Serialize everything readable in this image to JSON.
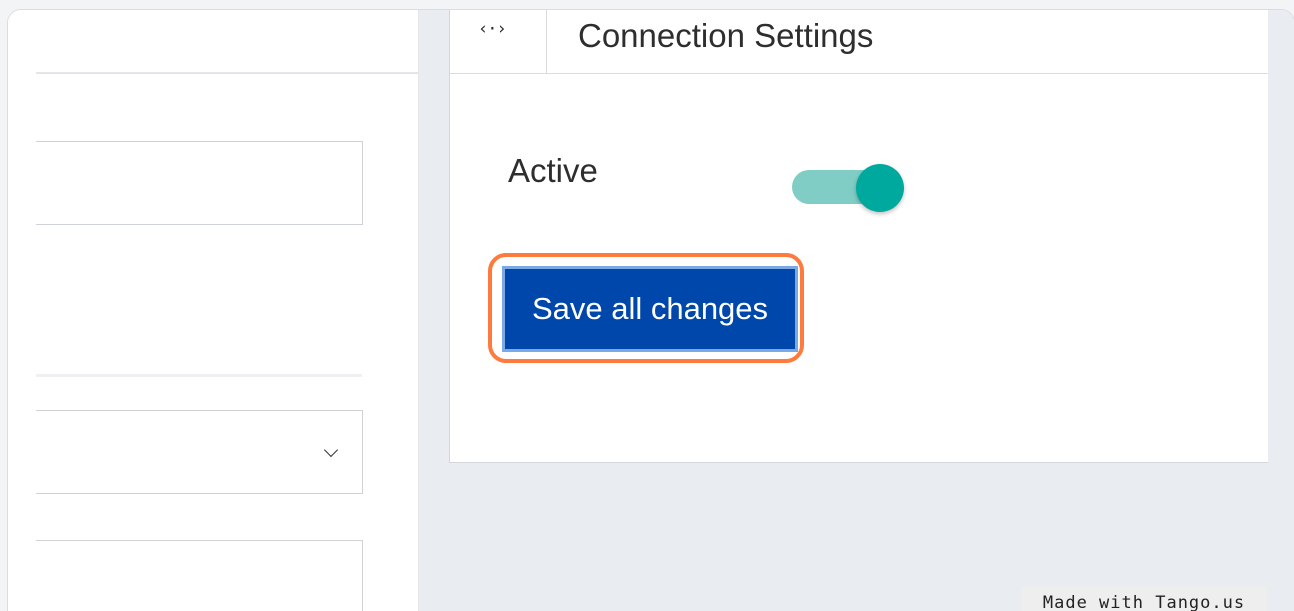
{
  "card": {
    "title": "Connection Settings",
    "code_icon_glyph": "‹·›"
  },
  "toggle": {
    "label": "Active",
    "state": "on",
    "color": "#00a99d"
  },
  "actions": {
    "save_label": "Save all changes",
    "save_color": "#0047ab",
    "highlight_color": "#ff7a3d"
  },
  "watermark": {
    "text": "Made with Tango.us"
  }
}
